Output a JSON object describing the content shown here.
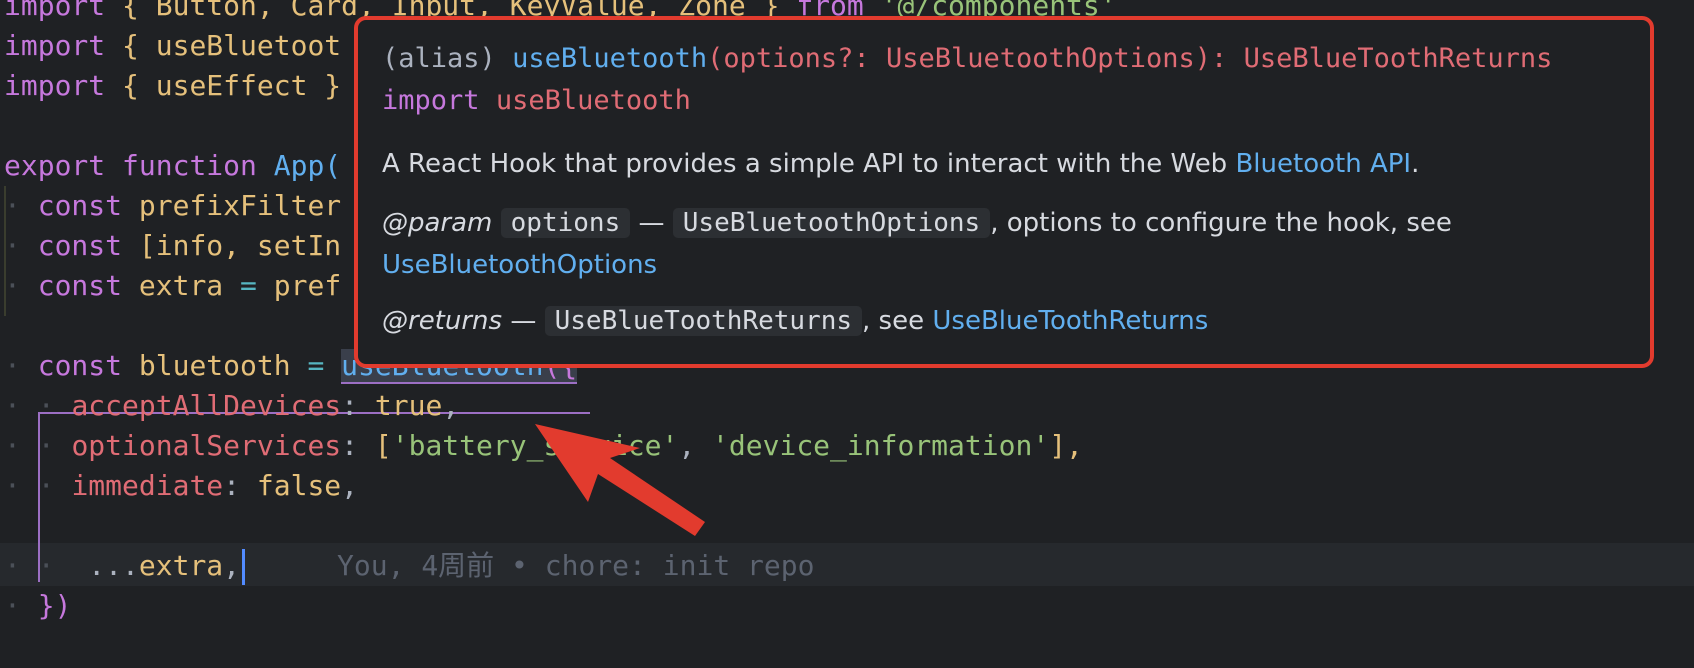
{
  "code": {
    "line1": {
      "import": "import",
      "items": "{ Button, Card, Input, KeyValue, Zone }",
      "from": "from",
      "path": "'@/components'"
    },
    "line2": {
      "import": "import",
      "items": "{ useBluetoot"
    },
    "line3": {
      "import": "import",
      "items": "{ useEffect }"
    },
    "line5": {
      "export": "export",
      "function": "function",
      "name": "App("
    },
    "line6": {
      "const": "const",
      "name": "prefixFilter"
    },
    "line7": {
      "const": "const",
      "name": "[info, setIn"
    },
    "line8": {
      "const": "const",
      "name": "extra",
      "eq": "=",
      "value": "pref"
    },
    "line10": {
      "const": "const",
      "name": "bluetooth",
      "eq": "=",
      "call": "useBluetooth",
      "open": "({"
    },
    "line11": {
      "prop": "acceptAllDevices",
      "colon": ":",
      "value": "true",
      "comma": ","
    },
    "line12": {
      "prop": "optionalServices",
      "colon": ":",
      "open": "[",
      "s1": "'battery_service'",
      "sep": ",",
      "s2": "'device_information'",
      "close": "],"
    },
    "line13": {
      "prop": "immediate",
      "colon": ":",
      "value": "false",
      "comma": ","
    },
    "line14": {
      "spread": "...",
      "name": "extra",
      "comma": ","
    },
    "line15": {
      "close": "})"
    }
  },
  "blame": {
    "text": "You, 4周前 • chore: init repo"
  },
  "hover": {
    "alias": "(alias)",
    "fn_name": "useBluetooth",
    "params": "(options?: UseBluetoothOptions): ",
    "return_type": "UseBlueToothReturns",
    "import_kw": "import",
    "import_name": "useBluetooth",
    "description": "A React Hook that provides a simple API to interact with the Web ",
    "description_link": "Bluetooth API",
    "description_end": ".",
    "param_tag": "@param",
    "param_name": "options",
    "param_dash": "—",
    "param_type": "UseBluetoothOptions",
    "param_text": ", options to configure the hook, see",
    "param_link": "UseBluetoothOptions",
    "returns_tag": "@returns",
    "returns_dash": "—",
    "returns_type": "UseBlueToothReturns",
    "returns_text": ", see ",
    "returns_link": "UseBlueToothReturns"
  },
  "colors": {
    "popup_border": "#e23b2e",
    "arrow": "#e23b2e",
    "background": "#1f2124"
  }
}
